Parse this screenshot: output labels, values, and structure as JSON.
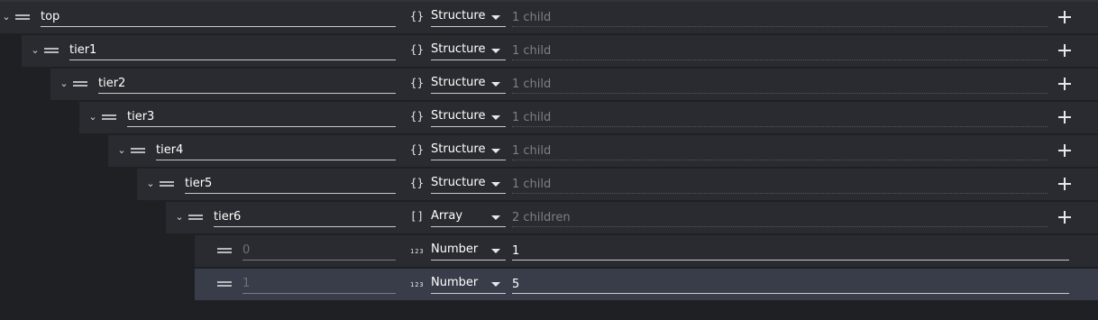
{
  "nodes": [
    {
      "key": "top",
      "type_icon": "{}",
      "type": "Structure",
      "summary": "1 child"
    },
    {
      "key": "tier1",
      "type_icon": "{}",
      "type": "Structure",
      "summary": "1 child"
    },
    {
      "key": "tier2",
      "type_icon": "{}",
      "type": "Structure",
      "summary": "1 child"
    },
    {
      "key": "tier3",
      "type_icon": "{}",
      "type": "Structure",
      "summary": "1 child"
    },
    {
      "key": "tier4",
      "type_icon": "{}",
      "type": "Structure",
      "summary": "1 child"
    },
    {
      "key": "tier5",
      "type_icon": "{}",
      "type": "Structure",
      "summary": "1 child"
    },
    {
      "key": "tier6",
      "type_icon": "[]",
      "type": "Array",
      "summary": "2 children"
    }
  ],
  "items": [
    {
      "index": "0",
      "type_icon": "123",
      "type": "Number",
      "value": "1",
      "selected": false
    },
    {
      "index": "1",
      "type_icon": "123",
      "type": "Number",
      "value": "5",
      "selected": true
    }
  ],
  "icons": {
    "expand": "chevron-down-icon",
    "drag": "drag-handle-icon",
    "add": "plus-icon"
  },
  "colors": {
    "background": "#1f2023",
    "row": "#2a2b30",
    "selected_row": "#393d49",
    "muted_text": "#7d7f87"
  }
}
